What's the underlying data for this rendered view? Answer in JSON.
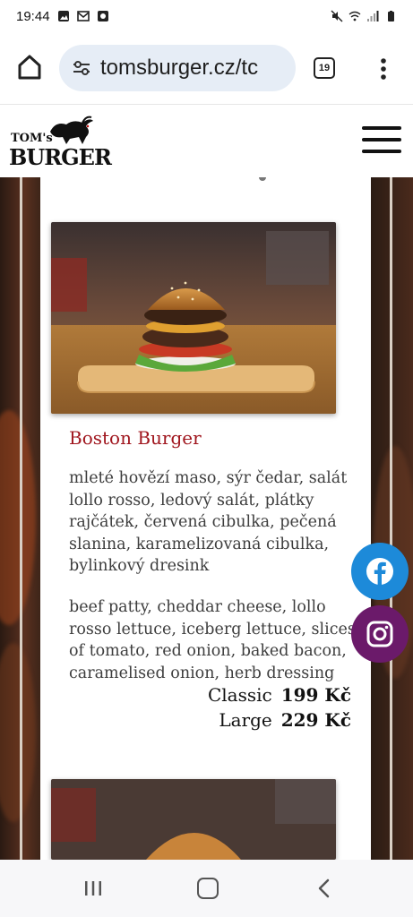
{
  "status_bar": {
    "time": "19:44",
    "left_icons": [
      "photo-icon",
      "gmail-icon",
      "app-icon"
    ],
    "right_icons": [
      "mute-icon",
      "wifi-icon",
      "signal-icon",
      "battery-icon"
    ]
  },
  "browser": {
    "url": "tomsburger.cz/tc",
    "tab_count": "19"
  },
  "site": {
    "logo_top": "TOM's",
    "logo_bottom": "BURGER"
  },
  "menu_item": {
    "title": "Boston Burger",
    "description_cz": "mleté hovězí maso, sýr čedar, salát lollo rosso, ledový salát, plátky rajčátek, červená cibulka, pečená slanina, karamelizovaná cibulka, bylinkový dresink",
    "description_en": "beef patty, cheddar cheese, lollo rosso lettuce, iceberg lettuce, slices of tomato, red onion, baked bacon, caramelised onion, herb dressing",
    "prices": [
      {
        "label": "Classic",
        "value": "199 Kč"
      },
      {
        "label": "Large",
        "value": "229 Kč"
      }
    ]
  },
  "colors": {
    "title": "#a0161e",
    "facebook": "#1d8ad9",
    "instagram": "#6b1a6a"
  }
}
